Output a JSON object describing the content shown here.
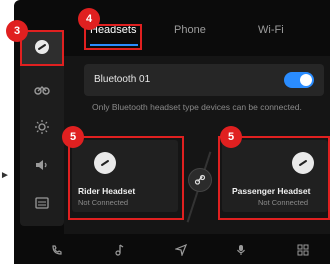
{
  "tabs": [
    "Headsets",
    "Phone",
    "Wi-Fi"
  ],
  "bluetooth": {
    "label": "Bluetooth 01",
    "enabled": true
  },
  "hint": "Only Bluetooth headset type devices can be connected.",
  "cards": [
    {
      "title": "Rider Headset",
      "status": "Not Connected"
    },
    {
      "title": "Passenger Headset",
      "status": "Not Connected"
    }
  ],
  "badges": [
    "3",
    "4",
    "5",
    "5"
  ],
  "colors": {
    "accent": "#2a8cff",
    "annotation": "#e02020"
  }
}
